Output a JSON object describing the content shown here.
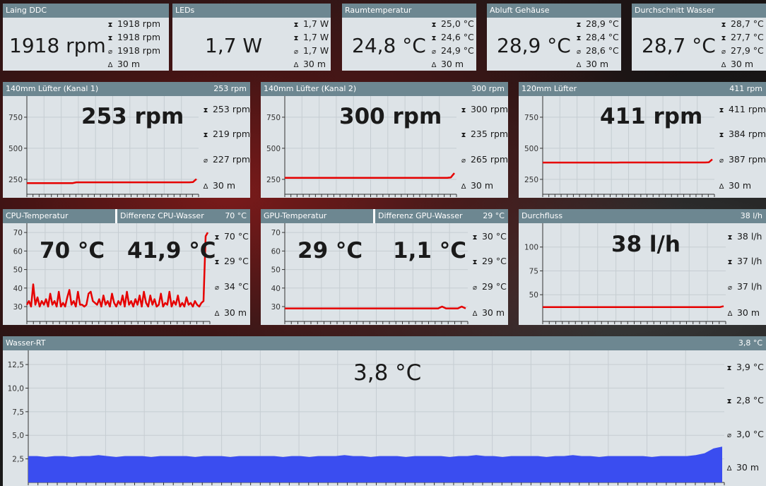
{
  "top": [
    {
      "title": "Laing DDC",
      "value": "1918 rpm",
      "max": "1918 rpm",
      "min": "1918 rpm",
      "avg": "1918 rpm",
      "period": "30 m"
    },
    {
      "title": "LEDs",
      "value": "1,7 W",
      "max": "1,7 W",
      "min": "1,7 W",
      "avg": "1,7 W",
      "period": "30 m"
    },
    {
      "title": "Raumtemperatur",
      "value": "24,8 °C",
      "max": "25,0 °C",
      "min": "24,6 °C",
      "avg": "24,9 °C",
      "period": "30 m"
    },
    {
      "title": "Abluft Gehäuse",
      "value": "28,9 °C",
      "max": "28,9 °C",
      "min": "28,4 °C",
      "avg": "28,6 °C",
      "period": "30 m"
    },
    {
      "title": "Durchschnitt Wasser",
      "value": "28,7 °C",
      "max": "28,7 °C",
      "min": "27,7 °C",
      "avg": "27,9 °C",
      "period": "30 m"
    }
  ],
  "fans": [
    {
      "title": "140mm Lüfter (Kanal 1)",
      "header_value": "253 rpm",
      "value": "253 rpm",
      "max": "253 rpm",
      "min": "219 rpm",
      "avg": "227 rpm",
      "period": "30 m"
    },
    {
      "title": "140mm Lüfter (Kanal 2)",
      "header_value": "300 rpm",
      "value": "300 rpm",
      "max": "300 rpm",
      "min": "235 rpm",
      "avg": "265 rpm",
      "period": "30 m"
    },
    {
      "title": "120mm Lüfter",
      "header_value": "411 rpm",
      "value": "411 rpm",
      "max": "411 rpm",
      "min": "384 rpm",
      "avg": "387 rpm",
      "period": "30 m"
    }
  ],
  "temps": [
    {
      "title": "CPU-Temperatur",
      "title2": "Differenz CPU-Wasser",
      "header_value": "70 °C",
      "value": "70 °C",
      "value2": "41,9 °C",
      "max": "70 °C",
      "min": "29 °C",
      "avg": "34 °C",
      "period": "30 m"
    },
    {
      "title": "GPU-Temperatur",
      "title2": "Differenz GPU-Wasser",
      "header_value": "29 °C",
      "value": "29 °C",
      "value2": "1,1 °C",
      "max": "30 °C",
      "min": "29 °C",
      "avg": "29 °C",
      "period": "30 m"
    },
    {
      "title": "Durchfluss",
      "header_value": "38 l/h",
      "value": "38 l/h",
      "max": "38 l/h",
      "min": "37 l/h",
      "avg": "37 l/h",
      "period": "30 m"
    }
  ],
  "water": {
    "title": "Wasser-RT",
    "header_value": "3,8 °C",
    "value": "3,8 °C",
    "max": "3,9 °C",
    "min": "2,8 °C",
    "avg": "3,0 °C",
    "period": "30 m"
  },
  "icons": {
    "max": "max-arrow-icon",
    "min": "min-arrow-icon",
    "avg": "average-icon",
    "period": "delta-time-icon"
  },
  "colors": {
    "header": "#6d8791",
    "panel": "#dde3e7",
    "line": "#e60000",
    "area": "#3a4df0"
  },
  "chart_data": [
    {
      "type": "line",
      "name": "fan1",
      "yticks": [
        250,
        500,
        750
      ],
      "ylim": [
        130,
        920
      ],
      "series": [
        {
          "values": [
            220,
            220,
            220,
            220,
            220,
            220,
            220,
            220,
            220,
            220,
            220,
            220,
            220,
            220,
            226,
            226,
            226,
            226,
            226,
            226,
            226,
            226,
            226,
            226,
            226,
            226,
            226,
            226,
            226,
            226,
            226,
            226,
            226,
            226,
            226,
            226,
            226,
            226,
            226,
            226,
            226,
            226,
            226,
            226,
            226,
            226,
            226,
            228,
            253
          ]
        }
      ]
    },
    {
      "type": "line",
      "name": "fan2",
      "yticks": [
        250,
        500,
        750
      ],
      "ylim": [
        130,
        920
      ],
      "series": [
        {
          "values": [
            262,
            262,
            262,
            262,
            262,
            262,
            262,
            262,
            262,
            262,
            262,
            262,
            262,
            262,
            262,
            262,
            262,
            262,
            262,
            262,
            262,
            262,
            262,
            262,
            262,
            262,
            262,
            262,
            262,
            262,
            262,
            262,
            262,
            262,
            262,
            262,
            262,
            262,
            262,
            262,
            262,
            262,
            262,
            262,
            262,
            262,
            262,
            265,
            300
          ]
        }
      ]
    },
    {
      "type": "line",
      "name": "fan3",
      "yticks": [
        250,
        500,
        750
      ],
      "ylim": [
        130,
        920
      ],
      "series": [
        {
          "values": [
            385,
            385,
            385,
            385,
            385,
            385,
            385,
            385,
            385,
            385,
            385,
            385,
            385,
            385,
            385,
            385,
            385,
            385,
            385,
            385,
            385,
            385,
            386,
            386,
            386,
            386,
            386,
            386,
            386,
            386,
            386,
            386,
            386,
            386,
            386,
            386,
            386,
            386,
            386,
            386,
            386,
            386,
            386,
            386,
            386,
            386,
            386,
            387,
            411
          ]
        }
      ]
    },
    {
      "type": "line",
      "name": "cpu",
      "yticks": [
        30,
        40,
        50,
        60,
        70
      ],
      "ylim": [
        22,
        75
      ],
      "series": [
        {
          "values": [
            31,
            33,
            30,
            42,
            31,
            35,
            30,
            33,
            31,
            34,
            30,
            37,
            31,
            33,
            30,
            38,
            30,
            32,
            30,
            35,
            39,
            31,
            33,
            30,
            38,
            31,
            31,
            30,
            31,
            37,
            38,
            33,
            32,
            31,
            34,
            30,
            36,
            31,
            33,
            30,
            37,
            32,
            30,
            33,
            31,
            36,
            30,
            38,
            31,
            33,
            30,
            34,
            31,
            36,
            30,
            38,
            32,
            30,
            36,
            31,
            34,
            30,
            31,
            37,
            30,
            32,
            31,
            38,
            30,
            33,
            31,
            36,
            30,
            32,
            30,
            35,
            31,
            32,
            30,
            33,
            31,
            30,
            32,
            33,
            68,
            70
          ]
        }
      ]
    },
    {
      "type": "line",
      "name": "gpu",
      "yticks": [
        30,
        40,
        50,
        60,
        70
      ],
      "ylim": [
        22,
        75
      ],
      "series": [
        {
          "values": [
            29,
            29,
            29,
            29,
            29,
            29,
            29,
            29,
            29,
            29,
            29,
            29,
            29,
            29,
            29,
            29,
            29,
            29,
            29,
            29,
            29,
            29,
            29,
            29,
            29,
            29,
            29,
            29,
            29,
            29,
            29,
            29,
            29,
            29,
            29,
            29,
            29,
            29,
            29,
            29,
            30,
            29,
            29,
            29,
            29,
            30,
            29
          ]
        }
      ]
    },
    {
      "type": "line",
      "name": "flow",
      "yticks": [
        50,
        75,
        100
      ],
      "ylim": [
        22,
        125
      ],
      "series": [
        {
          "values": [
            37,
            37,
            37,
            37,
            37,
            37,
            37,
            37,
            37,
            37,
            37,
            37,
            37,
            37,
            37,
            37,
            37,
            37,
            37,
            37,
            37,
            37,
            37,
            37,
            37,
            37,
            37,
            37,
            37,
            37,
            37,
            37,
            37,
            37,
            37,
            37,
            37,
            37,
            37,
            37,
            37,
            37,
            37,
            37,
            37,
            37,
            37,
            38
          ]
        }
      ]
    },
    {
      "type": "area",
      "name": "wasser",
      "yticks": [
        "2,5",
        "5,0",
        "7,5",
        "10,0",
        "12,5"
      ],
      "ylim": [
        0,
        14
      ],
      "series": [
        {
          "values": [
            2.8,
            2.8,
            2.7,
            2.8,
            2.8,
            2.7,
            2.8,
            2.8,
            2.9,
            2.8,
            2.7,
            2.8,
            2.8,
            2.8,
            2.7,
            2.8,
            2.8,
            2.8,
            2.8,
            2.7,
            2.8,
            2.8,
            2.8,
            2.7,
            2.8,
            2.8,
            2.8,
            2.8,
            2.8,
            2.7,
            2.8,
            2.8,
            2.7,
            2.8,
            2.8,
            2.8,
            2.9,
            2.8,
            2.8,
            2.7,
            2.8,
            2.8,
            2.8,
            2.7,
            2.8,
            2.8,
            2.8,
            2.8,
            2.7,
            2.8,
            2.8,
            2.9,
            2.8,
            2.8,
            2.7,
            2.8,
            2.8,
            2.8,
            2.8,
            2.7,
            2.8,
            2.8,
            2.9,
            2.8,
            2.8,
            2.7,
            2.8,
            2.8,
            2.8,
            2.8,
            2.8,
            2.7,
            2.8,
            2.8,
            2.8,
            2.8,
            2.9,
            3.1,
            3.6,
            3.8
          ]
        }
      ]
    }
  ]
}
